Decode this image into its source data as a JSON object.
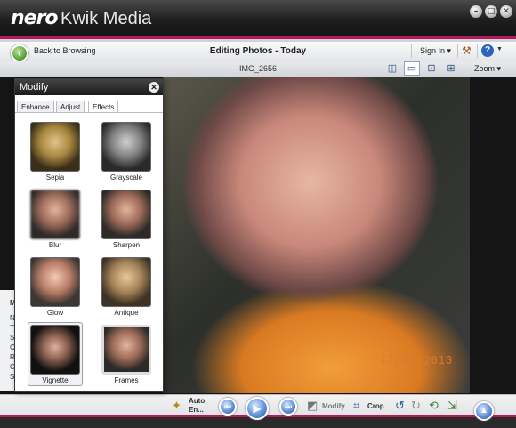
{
  "titlebar": {
    "logo": "nero",
    "title": "Kwik Media"
  },
  "nav": {
    "back_label": "Back to Browsing",
    "page_title": "Editing Photos - Today",
    "sign_in": "Sign In",
    "file_name": "IMG_2656",
    "zoom": "Zoom"
  },
  "photo": {
    "date_stamp": "17/05/2010"
  },
  "modify_panel": {
    "title": "Modify",
    "tabs": [
      "Enhance",
      "Adjust",
      "Effects"
    ],
    "active_tab": "Effects",
    "effects": [
      "Sepia",
      "Grayscale",
      "Blur",
      "Sharpen",
      "Glow",
      "Antique",
      "Vignette",
      "Frames"
    ],
    "selected_effect": "Vignette"
  },
  "left_panel": {
    "letters": [
      "M",
      "N",
      "Ty",
      "Si",
      "C",
      "R",
      "C",
      "St"
    ]
  },
  "toolbar": {
    "auto_enhance": "Auto En...",
    "modify": "Modify",
    "crop": "Crop"
  },
  "colors": {
    "accent": "#b3195d",
    "title_bg": "#1e1e1e",
    "button_blue": "#5a8bd3"
  },
  "icons": [
    "back-arrow-icon",
    "minimize-icon",
    "maximize-icon",
    "close-icon",
    "tools-icon",
    "help-icon",
    "wand-icon",
    "previous-icon",
    "play-icon",
    "next-icon",
    "modify-icon",
    "crop-icon",
    "rotate-left-icon",
    "rotate-right-icon",
    "export-icon",
    "upload-icon"
  ]
}
